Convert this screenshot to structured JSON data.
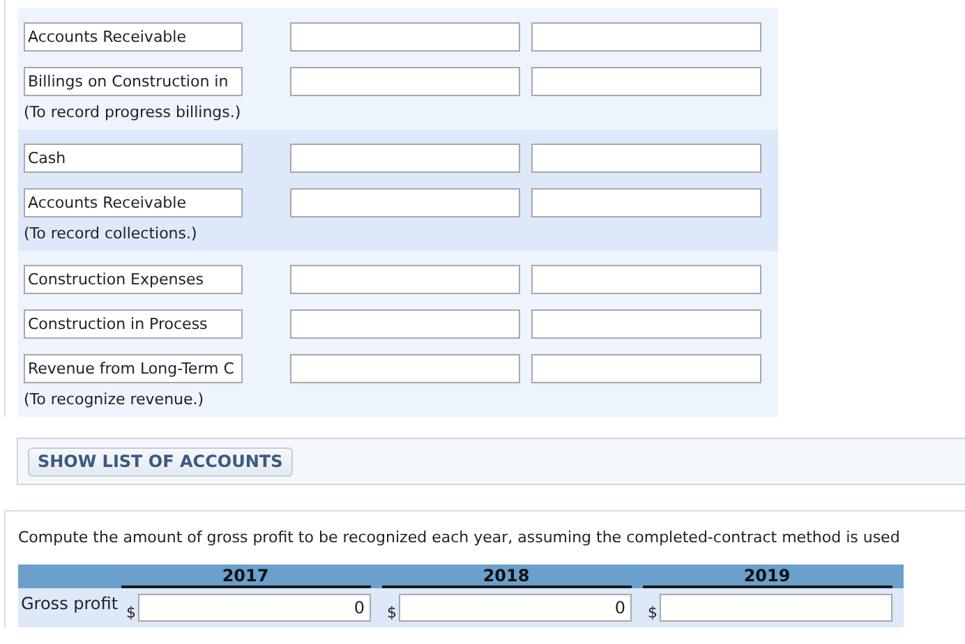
{
  "journal_groups": [
    {
      "entries": [
        {
          "account": "Accounts Receivable"
        },
        {
          "account": "Billings on Construction in"
        }
      ],
      "note": "(To record progress billings.)"
    },
    {
      "entries": [
        {
          "account": "Cash"
        },
        {
          "account": "Accounts Receivable"
        }
      ],
      "note": "(To record collections.)"
    },
    {
      "entries": [
        {
          "account": "Construction Expenses"
        },
        {
          "account": "Construction in Process"
        },
        {
          "account": "Revenue from Long-Term C"
        }
      ],
      "note": "(To recognize revenue.)"
    }
  ],
  "show_accounts_button": "SHOW LIST OF ACCOUNTS",
  "question": "Compute the amount of gross profit to be recognized each year, assuming the completed-contract method is used",
  "gross_profit_table": {
    "columns": [
      "2017",
      "2018",
      "2019"
    ],
    "rows": [
      {
        "label": "Gross profit",
        "cells": [
          {
            "currency": "$",
            "value": "0"
          },
          {
            "currency": "$",
            "value": "0"
          },
          {
            "currency": "$"
          }
        ]
      }
    ]
  }
}
